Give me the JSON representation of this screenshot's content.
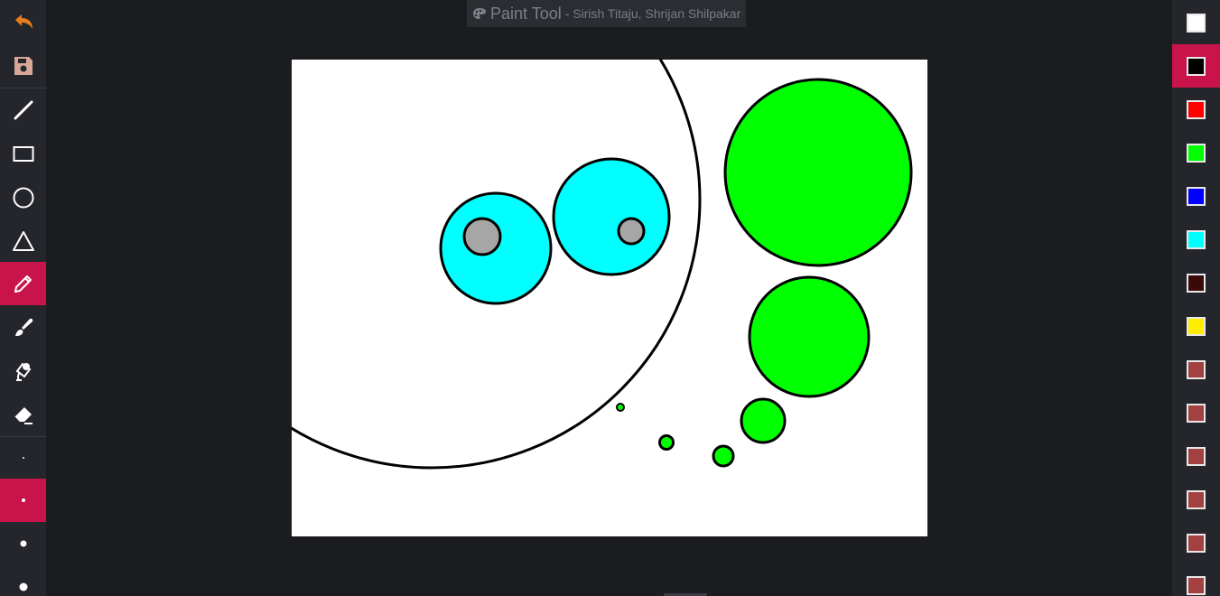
{
  "app": {
    "title_icon": "palette-icon",
    "title": "Paint Tool",
    "subtitle": "- Sirish Titaju, Shrijan Shilpakar"
  },
  "toolbar": {
    "tools": [
      {
        "id": "undo",
        "icon": "undo-icon",
        "color": "#e87c1e",
        "active": false
      },
      {
        "id": "save",
        "icon": "save-icon",
        "color": "#d8a79a",
        "active": false
      },
      {
        "id": "line",
        "icon": "line-icon",
        "active": false
      },
      {
        "id": "rectangle",
        "icon": "rectangle-icon",
        "active": false
      },
      {
        "id": "circle",
        "icon": "circle-icon",
        "active": false
      },
      {
        "id": "triangle",
        "icon": "triangle-icon",
        "active": false
      },
      {
        "id": "pencil",
        "icon": "pencil-icon",
        "active": true
      },
      {
        "id": "brush",
        "icon": "brush-icon",
        "active": false
      },
      {
        "id": "paint-bucket",
        "icon": "paint-bucket-icon",
        "active": false
      },
      {
        "id": "eraser",
        "icon": "eraser-icon",
        "active": false
      }
    ],
    "sizes": [
      {
        "id": "size-1",
        "active": false
      },
      {
        "id": "size-2",
        "active": true
      },
      {
        "id": "size-3",
        "active": false
      },
      {
        "id": "size-4",
        "active": false
      }
    ],
    "active_color": "#c8144a"
  },
  "palette": {
    "colors": [
      {
        "hex": "#ffffff",
        "active": false
      },
      {
        "hex": "#000000",
        "active": true
      },
      {
        "hex": "#ff0000",
        "active": false
      },
      {
        "hex": "#00ff00",
        "active": false
      },
      {
        "hex": "#0000ff",
        "active": false
      },
      {
        "hex": "#00ffff",
        "active": false
      },
      {
        "hex": "#3a0a0a",
        "active": false
      },
      {
        "hex": "#ffee00",
        "active": false
      },
      {
        "hex": "#a34040",
        "active": false
      },
      {
        "hex": "#a34040",
        "active": false
      },
      {
        "hex": "#a34040",
        "active": false
      },
      {
        "hex": "#a34040",
        "active": false
      },
      {
        "hex": "#a34040",
        "active": false
      },
      {
        "hex": "#a34040",
        "active": false
      }
    ]
  },
  "canvas": {
    "background": "#ffffff",
    "shapes": [
      {
        "type": "circle",
        "fill": "none",
        "stroke": "#000000"
      },
      {
        "type": "circle",
        "fill": "#00ffff",
        "stroke": "#000000"
      },
      {
        "type": "circle",
        "fill": "#a6a6a6",
        "stroke": "#000000"
      },
      {
        "type": "circle",
        "fill": "#00ffff",
        "stroke": "#000000"
      },
      {
        "type": "circle",
        "fill": "#a6a6a6",
        "stroke": "#000000"
      },
      {
        "type": "circle",
        "fill": "#00ff00",
        "stroke": "#000000"
      },
      {
        "type": "circle",
        "fill": "#00ff00",
        "stroke": "#000000"
      },
      {
        "type": "circle",
        "fill": "#00ff00",
        "stroke": "#000000"
      },
      {
        "type": "circle",
        "fill": "#00ff00",
        "stroke": "#000000"
      },
      {
        "type": "circle",
        "fill": "#00ff00",
        "stroke": "#000000"
      },
      {
        "type": "circle",
        "fill": "#00ff00",
        "stroke": "#000000"
      }
    ]
  }
}
